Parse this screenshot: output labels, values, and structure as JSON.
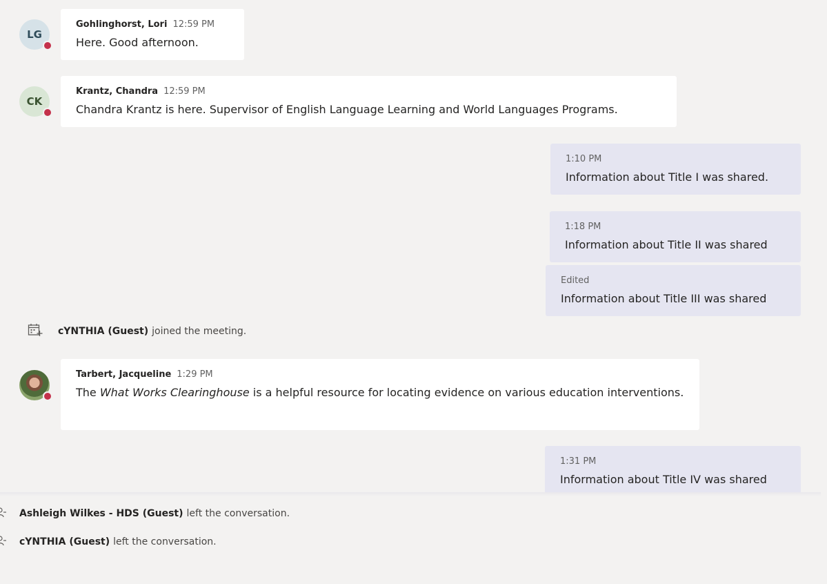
{
  "messages": {
    "m1": {
      "initials": "LG",
      "name": "Gohlinghorst, Lori",
      "time": "12:59 PM",
      "text": "Here. Good afternoon."
    },
    "m2": {
      "initials": "CK",
      "name": "Krantz, Chandra",
      "time": "12:59 PM",
      "text": "Chandra Krantz is here. Supervisor of English Language Learning and World Languages Programs."
    },
    "m3": {
      "name": "Tarbert, Jacqueline",
      "time": "1:29 PM",
      "text_before": "The ",
      "text_italic": "What Works Clearinghouse",
      "text_after": " is a helpful resource for locating evidence on various education interventions."
    }
  },
  "outgoing": [
    {
      "time": "1:10 PM",
      "text": "Information about Title I was shared."
    },
    {
      "time": "1:18 PM",
      "text": "Information about Title II was shared"
    },
    {
      "time": "Edited",
      "text": "Information about Title III was shared"
    },
    {
      "time": "1:31 PM",
      "text": "Information about Title IV was shared"
    }
  ],
  "system": {
    "joined": {
      "name": "cYNTHIA (Guest)",
      "action": "joined the meeting."
    },
    "left1": {
      "name": "Ashleigh Wilkes - HDS (Guest)",
      "action": "left the conversation."
    },
    "left2": {
      "name": "cYNTHIA (Guest)",
      "action": "left the conversation."
    }
  },
  "colors": {
    "background": "#f3f2f1",
    "outgoing_bubble": "#e5e5f1",
    "presence_busy": "#c4314b"
  },
  "icons": {
    "joined": "calendar-add-icon",
    "left": "person-leave-icon",
    "presence": "presence-busy-icon"
  }
}
